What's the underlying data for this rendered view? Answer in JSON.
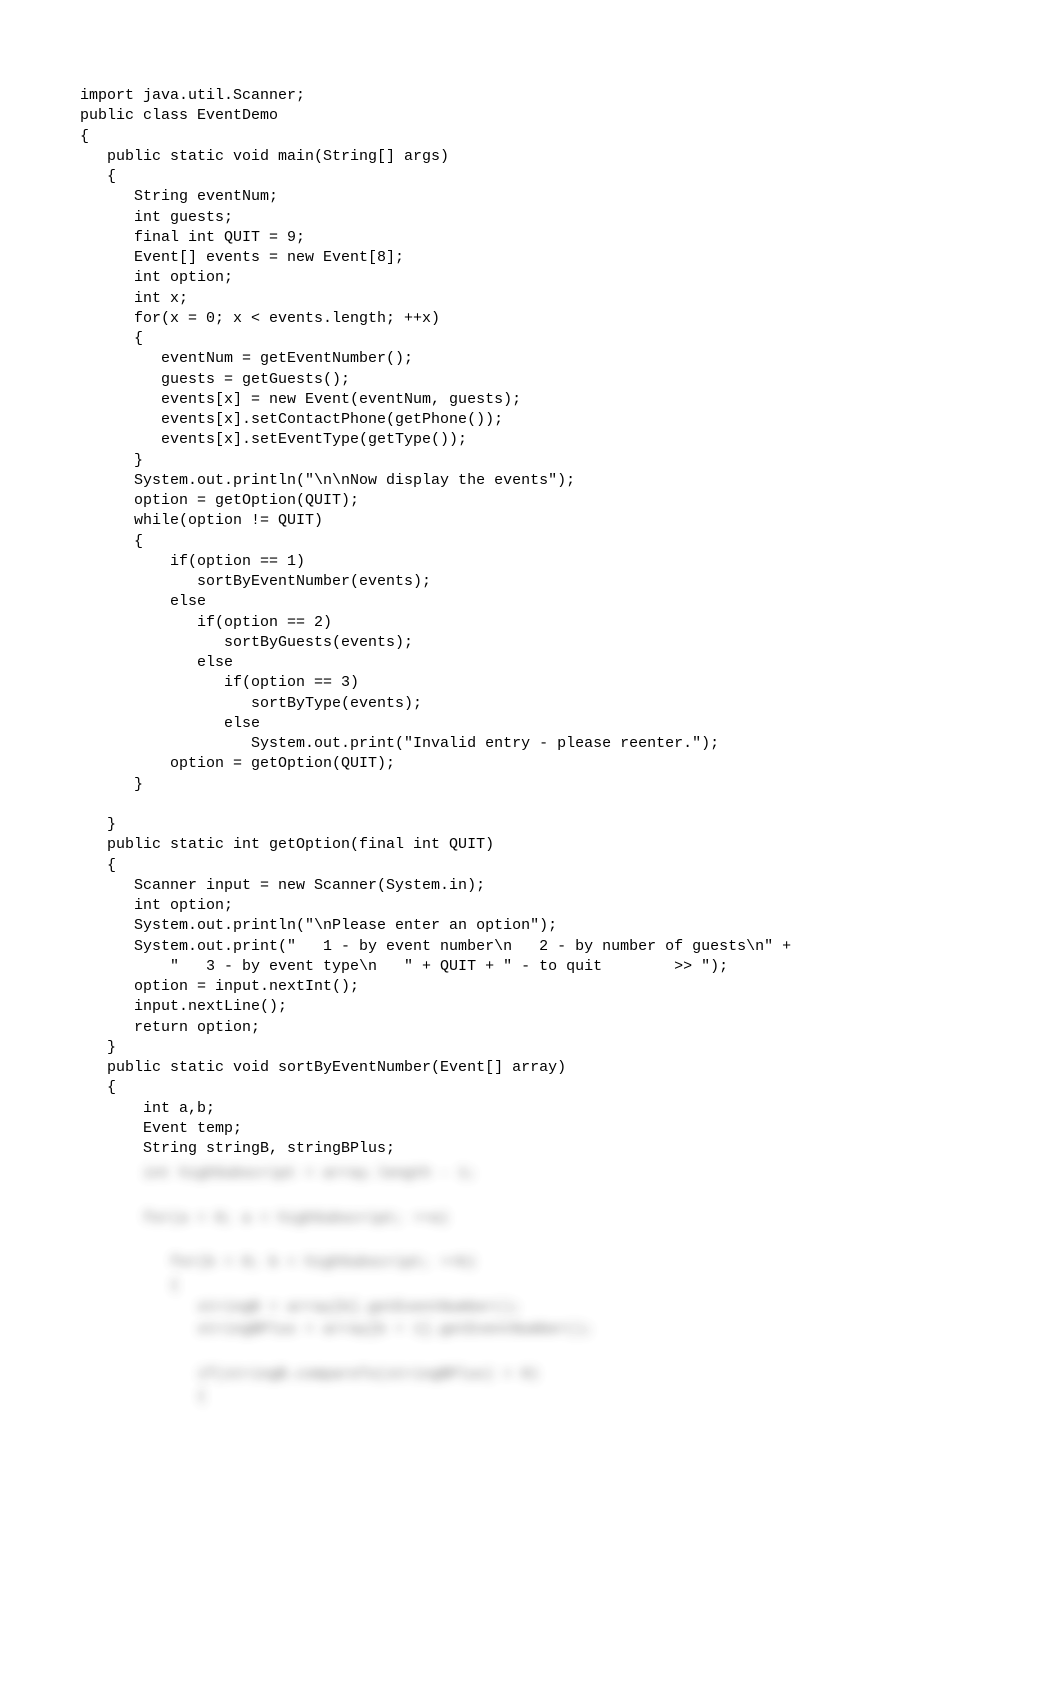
{
  "code": {
    "lines": [
      "import java.util.Scanner;",
      "public class EventDemo",
      "{",
      "   public static void main(String[] args)",
      "   {",
      "      String eventNum;",
      "      int guests;",
      "      final int QUIT = 9;",
      "      Event[] events = new Event[8];",
      "      int option;",
      "      int x;",
      "      for(x = 0; x < events.length; ++x)",
      "      {",
      "         eventNum = getEventNumber();",
      "         guests = getGuests();",
      "         events[x] = new Event(eventNum, guests);",
      "         events[x].setContactPhone(getPhone());",
      "         events[x].setEventType(getType());",
      "      }",
      "      System.out.println(\"\\n\\nNow display the events\");",
      "      option = getOption(QUIT);",
      "      while(option != QUIT)",
      "      {",
      "          if(option == 1)",
      "             sortByEventNumber(events);",
      "          else",
      "             if(option == 2)",
      "                sortByGuests(events);",
      "             else",
      "                if(option == 3)",
      "                   sortByType(events);",
      "                else",
      "                   System.out.print(\"Invalid entry - please reenter.\");",
      "          option = getOption(QUIT);",
      "      }",
      "",
      "   }",
      "   public static int getOption(final int QUIT)",
      "   {",
      "      Scanner input = new Scanner(System.in);",
      "      int option;",
      "      System.out.println(\"\\nPlease enter an option\");",
      "      System.out.print(\"   1 - by event number\\n   2 - by number of guests\\n\" +",
      "          \"   3 - by event type\\n   \" + QUIT + \" - to quit        >> \");",
      "      option = input.nextInt();",
      "      input.nextLine();",
      "      return option;",
      "   }",
      "   public static void sortByEventNumber(Event[] array)",
      "   {",
      "       int a,b;",
      "       Event temp;",
      "       String stringB, stringBPlus;"
    ]
  },
  "blurred": {
    "lines": [
      "       int highSubscript = array.length - 1;",
      "",
      "       for(a = 0; a < highSubscript; ++a)",
      "",
      "          for(b = 0; b < highSubscript; ++b)",
      "          {",
      "             stringB = array[b].getEventNumber();",
      "             stringBPlus = array[b + 1].getEventNumber();",
      "",
      "             if(stringB.compareTo(stringBPlus) > 0)",
      "             {"
    ]
  }
}
